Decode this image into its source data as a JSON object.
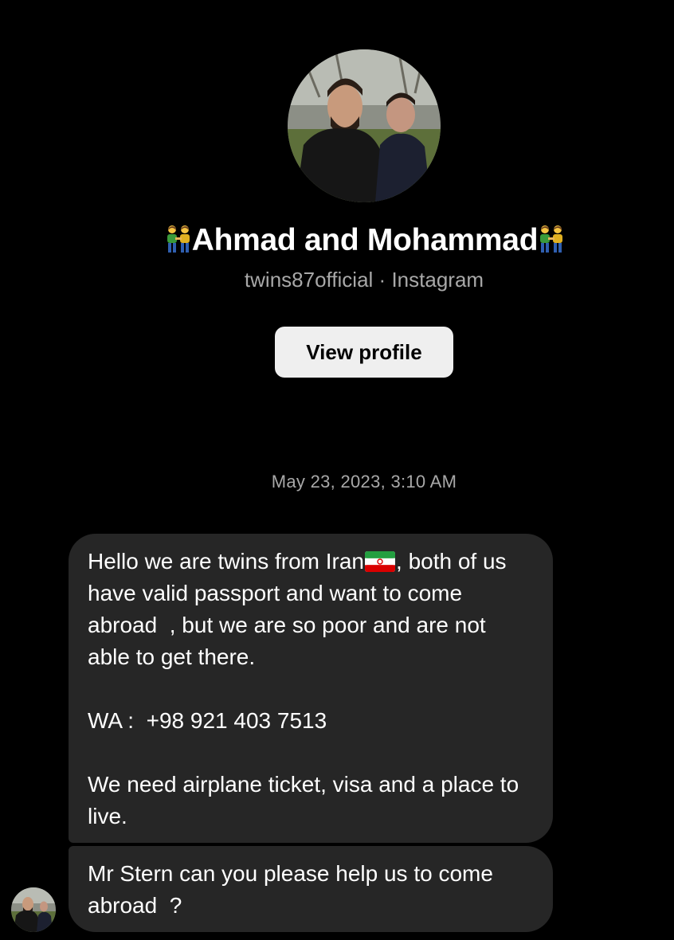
{
  "profile": {
    "avatar_icon": "twins-profile-photo",
    "display_name_prefix_icon": "couple-emoji-icon",
    "display_name": "Ahmad and Mohammad",
    "display_name_suffix_icon": "couple-emoji-icon",
    "username": "twins87official",
    "separator": "·",
    "platform": "Instagram",
    "view_profile_label": "View profile"
  },
  "conversation": {
    "timestamp": "May 23, 2023, 3:10 AM",
    "messages": [
      {
        "part1": "Hello we are twins from Iran",
        "flag_icon": "iran-flag-icon",
        "part2": ", both of us have valid passport and want to come abroad  , but we are so poor and are not able to get there.\n\nWA :  +98 921 403 7513\n\nWe need airplane ticket, visa and a place to live."
      },
      {
        "text": "Mr Stern can you please help us to come abroad  ?"
      }
    ],
    "sender_avatar_icon": "twins-profile-photo"
  },
  "colors": {
    "background": "#000000",
    "bubble": "#262626",
    "muted_text": "#a8a8a8",
    "button_bg": "#efefef"
  }
}
